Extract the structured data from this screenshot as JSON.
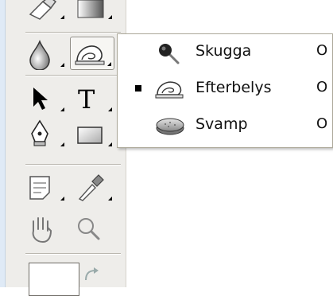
{
  "toolbox": {
    "tools": [
      {
        "name": "eraser-tool",
        "icon": "eraser-icon"
      },
      {
        "name": "gradient-tool",
        "icon": "gradient-icon"
      },
      {
        "name": "blur-tool",
        "icon": "drop-icon"
      },
      {
        "name": "dodge-tool",
        "icon": "dodge-icon",
        "selected": true
      },
      {
        "name": "path-selection-tool",
        "icon": "arrow-icon"
      },
      {
        "name": "type-tool",
        "icon": "type-icon",
        "glyph": "T"
      },
      {
        "name": "pen-tool",
        "icon": "pen-icon"
      },
      {
        "name": "rectangle-tool",
        "icon": "rectangle-icon"
      },
      {
        "name": "notes-tool",
        "icon": "notes-icon"
      },
      {
        "name": "eyedropper-tool",
        "icon": "eyedropper-icon"
      },
      {
        "name": "hand-tool",
        "icon": "hand-icon"
      },
      {
        "name": "zoom-tool",
        "icon": "magnifier-icon"
      }
    ]
  },
  "flyout": {
    "items": [
      {
        "label": "Skugga",
        "shortcut": "O",
        "icon": "burn-icon",
        "active": false
      },
      {
        "label": "Efterbelys",
        "shortcut": "O",
        "icon": "dodge-icon",
        "active": true
      },
      {
        "label": "Svamp",
        "shortcut": "O",
        "icon": "sponge-icon",
        "active": false
      }
    ]
  }
}
